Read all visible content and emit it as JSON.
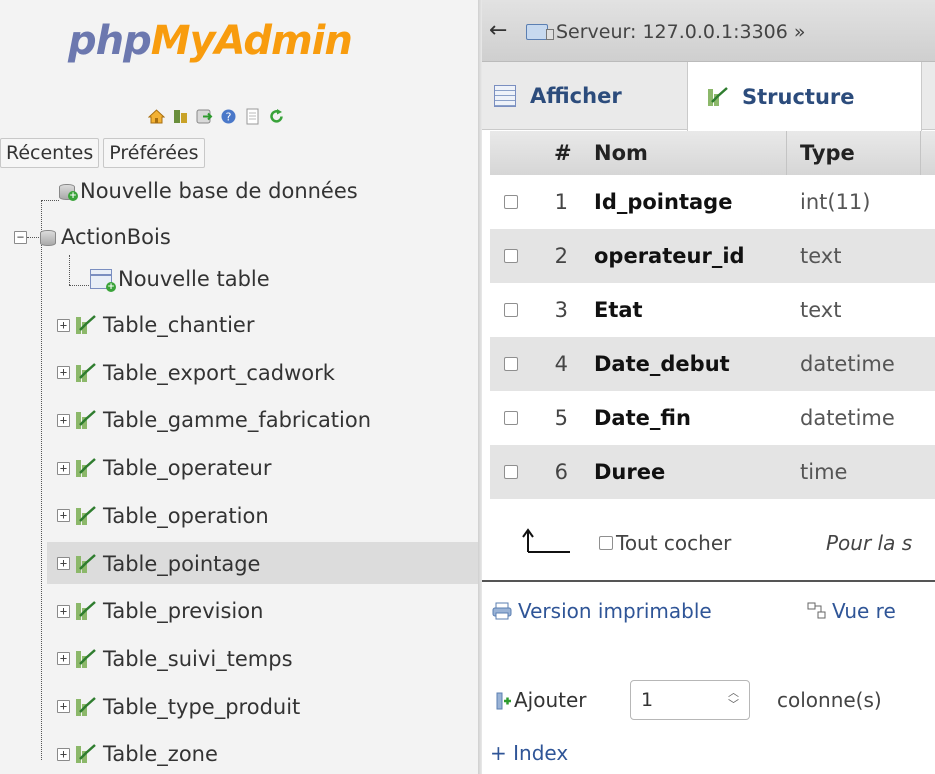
{
  "nav": {
    "logo": {
      "part1": "php",
      "part2": "MyAdmin"
    },
    "quick_icons": [
      "home-icon",
      "database-icon",
      "exit-icon",
      "help-icon",
      "documentation-icon",
      "reload-icon"
    ],
    "tabs": {
      "recent": "Récentes",
      "favorites": "Préférées"
    },
    "new_database": "Nouvelle base de données",
    "database": {
      "name": "ActionBois",
      "new_table": "Nouvelle table",
      "tables": [
        "Table_chantier",
        "Table_export_cadwork",
        "Table_gamme_fabrication",
        "Table_operateur",
        "Table_operation",
        "Table_pointage",
        "Table_prevision",
        "Table_suivi_temps",
        "Table_type_produit",
        "Table_zone"
      ],
      "selected_table": "Table_pointage"
    }
  },
  "topbar": {
    "back": "←",
    "breadcrumb": "Serveur: 127.0.0.1:3306 »"
  },
  "tabs": {
    "browse": "Afficher",
    "structure": "Structure"
  },
  "structure_table": {
    "headers": {
      "num": "#",
      "name": "Nom",
      "type": "Type"
    },
    "rows": [
      {
        "num": "1",
        "name": "Id_pointage",
        "type": "int(11)"
      },
      {
        "num": "2",
        "name": "operateur_id",
        "type": "text"
      },
      {
        "num": "3",
        "name": "Etat",
        "type": "text"
      },
      {
        "num": "4",
        "name": "Date_debut",
        "type": "datetime"
      },
      {
        "num": "5",
        "name": "Date_fin",
        "type": "datetime"
      },
      {
        "num": "6",
        "name": "Duree",
        "type": "time"
      }
    ]
  },
  "bulk": {
    "check_all": "Tout cocher",
    "with_selected": "Pour la s"
  },
  "actions": {
    "print": "Version imprimable",
    "relation_view": "Vue re"
  },
  "add_columns": {
    "label": "Ajouter",
    "count": "1",
    "unit": "colonne(s)"
  },
  "index_link": "+ Index",
  "colors": {
    "logo_php": "#6c78af",
    "logo_myadmin": "#f89c0e",
    "link": "#2f5597",
    "tab_text": "#2c4c7c",
    "row_stripe": "#e4e4e4",
    "selected_nav_row": "#dcdcdc"
  }
}
